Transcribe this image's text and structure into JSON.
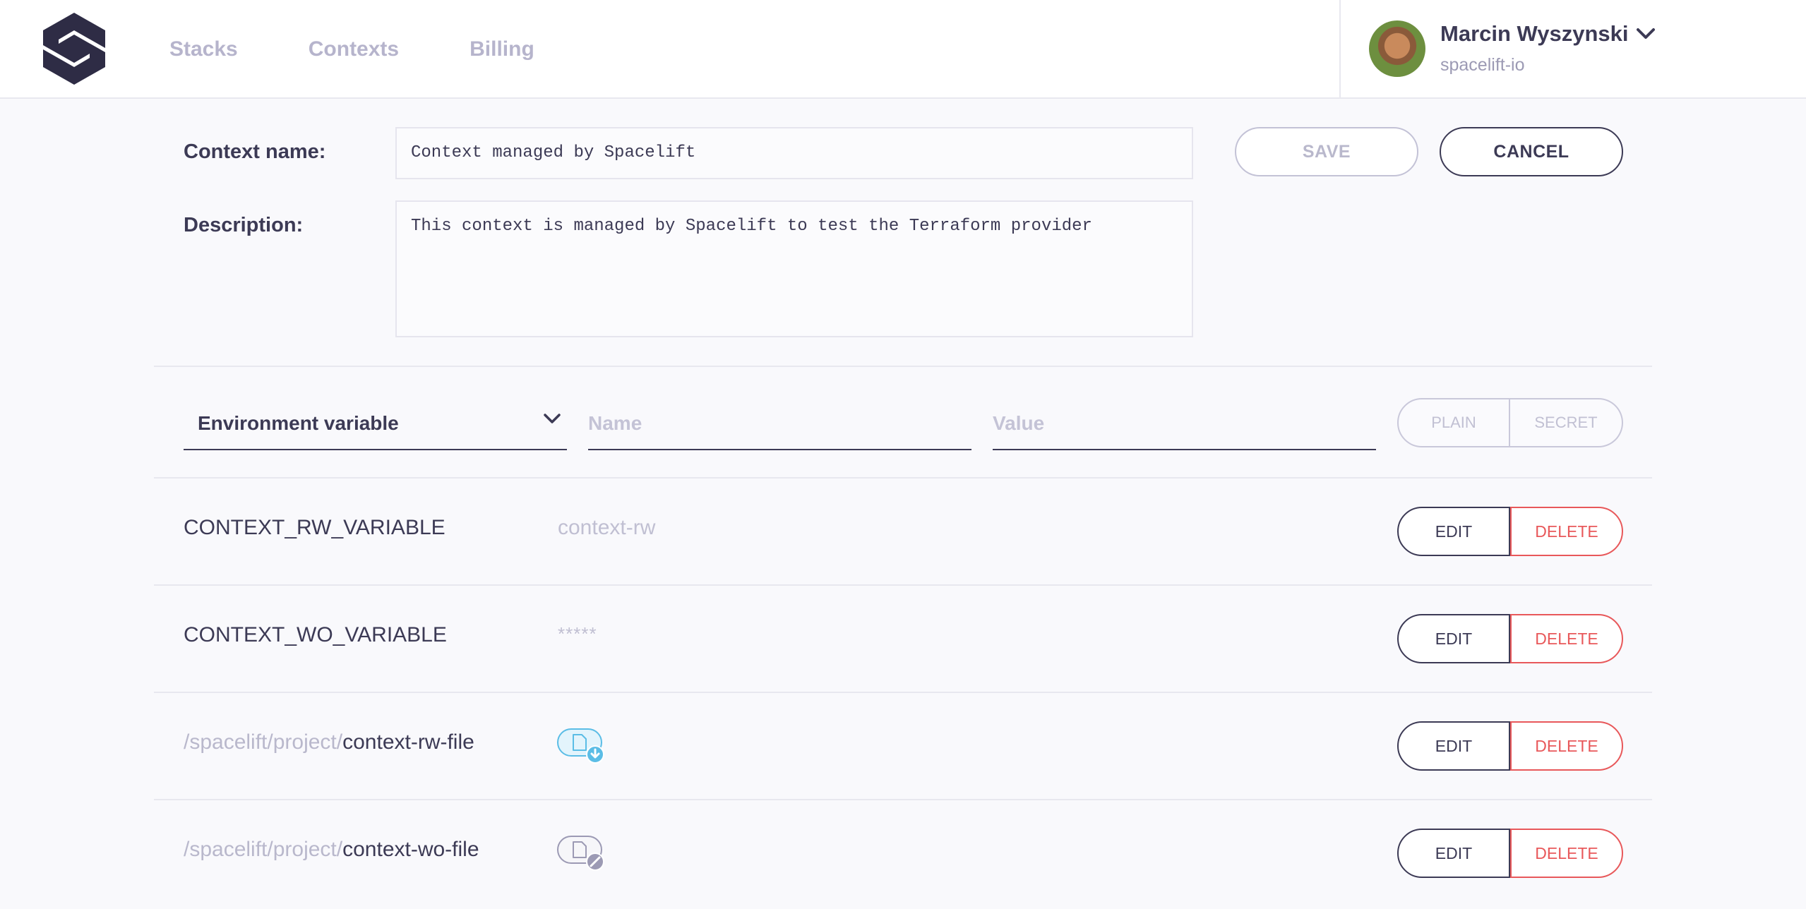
{
  "nav": {
    "items": [
      "Stacks",
      "Contexts",
      "Billing"
    ]
  },
  "user": {
    "name": "Marcin Wyszynski",
    "org": "spacelift-io"
  },
  "form": {
    "name_label": "Context name:",
    "name_value": "Context managed by Spacelift",
    "description_label": "Description:",
    "description_value": "This context is managed by Spacelift to test the Terraform provider",
    "save_label": "SAVE",
    "cancel_label": "CANCEL"
  },
  "new_item": {
    "type_selected": "Environment variable",
    "name_placeholder": "Name",
    "value_placeholder": "Value",
    "plain_label": "PLAIN",
    "secret_label": "SECRET"
  },
  "items": [
    {
      "key": "CONTEXT_RW_VARIABLE",
      "value": "context-rw",
      "edit_label": "EDIT",
      "delete_label": "DELETE"
    },
    {
      "key": "CONTEXT_WO_VARIABLE",
      "value": "*****",
      "edit_label": "EDIT",
      "delete_label": "DELETE"
    },
    {
      "path_prefix": "/spacelift/project/",
      "file": "context-rw-file",
      "icon": "file-download-icon",
      "edit_label": "EDIT",
      "delete_label": "DELETE"
    },
    {
      "path_prefix": "/spacelift/project/",
      "file": "context-wo-file",
      "icon": "file-writeonly-icon",
      "edit_label": "EDIT",
      "delete_label": "DELETE"
    }
  ],
  "colors": {
    "text": "#3c3a55",
    "muted": "#b6b4cc",
    "danger": "#e8585a",
    "accent": "#5bbde6"
  }
}
